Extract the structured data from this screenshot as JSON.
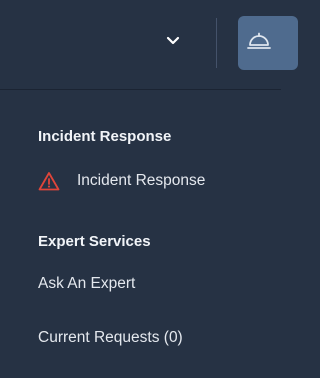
{
  "topbar": {
    "dropdown_icon": "chevron-down-icon",
    "service_icon": "service-bell-icon",
    "accent_color": "#4f6b8e"
  },
  "menu": {
    "sections": [
      {
        "title": "Incident Response",
        "items": [
          {
            "label": "Incident Response",
            "icon": "warning-triangle-icon",
            "icon_color": "#e0453a"
          }
        ]
      },
      {
        "title": "Expert Services",
        "items": [
          {
            "label": "Ask An Expert"
          },
          {
            "label": "Current Requests (0)"
          }
        ]
      }
    ]
  }
}
